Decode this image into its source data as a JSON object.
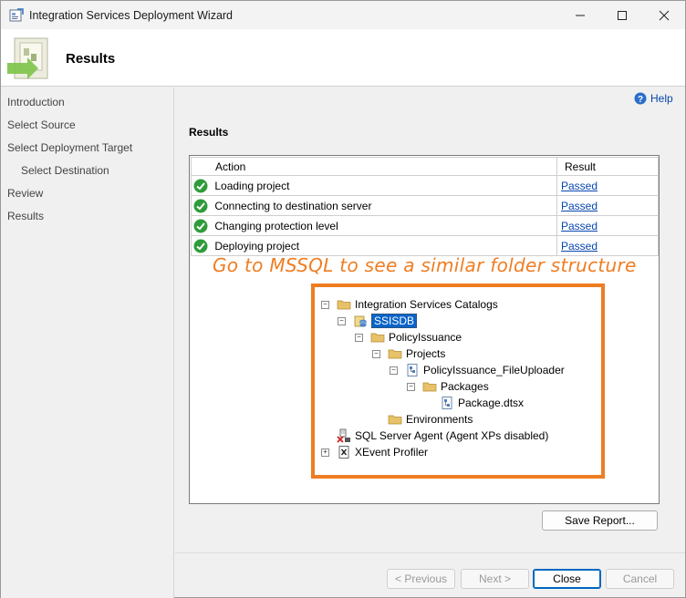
{
  "window": {
    "title": "Integration Services Deployment Wizard"
  },
  "header": {
    "title": "Results"
  },
  "nav": {
    "items": [
      {
        "label": "Introduction"
      },
      {
        "label": "Select Source"
      },
      {
        "label": "Select Deployment Target"
      },
      {
        "label": "Select Destination"
      },
      {
        "label": "Review"
      },
      {
        "label": "Results"
      }
    ]
  },
  "main": {
    "help_label": "Help",
    "section_title": "Results",
    "table": {
      "columns": [
        "Action",
        "Result"
      ],
      "rows": [
        {
          "action": "Loading project",
          "result": "Passed"
        },
        {
          "action": "Connecting to destination server",
          "result": "Passed"
        },
        {
          "action": "Changing protection level",
          "result": "Passed"
        },
        {
          "action": "Deploying project",
          "result": "Passed"
        }
      ]
    },
    "annotation": "Go to MSSQL to see a similar folder structure",
    "tree": [
      {
        "label": "Integration Services Catalogs",
        "icon": "folder-icon",
        "toggle": "minus"
      },
      {
        "label": "SSISDB",
        "icon": "database-icon",
        "toggle": "minus",
        "selected": true
      },
      {
        "label": "PolicyIssuance",
        "icon": "folder-icon",
        "toggle": "minus"
      },
      {
        "label": "Projects",
        "icon": "folder-icon",
        "toggle": "minus"
      },
      {
        "label": "PolicyIssuance_FileUploader",
        "icon": "project-icon",
        "toggle": "minus"
      },
      {
        "label": "Packages",
        "icon": "folder-icon",
        "toggle": "minus"
      },
      {
        "label": "Package.dtsx",
        "icon": "package-icon",
        "toggle": ""
      },
      {
        "label": "Environments",
        "icon": "folder-icon",
        "toggle": ""
      },
      {
        "label": "SQL Server Agent (Agent XPs disabled)",
        "icon": "agent-icon",
        "toggle": ""
      },
      {
        "label": "XEvent Profiler",
        "icon": "profiler-icon",
        "toggle": "plus"
      }
    ],
    "save_report_label": "Save Report..."
  },
  "footer": {
    "previous_label": "< Previous",
    "next_label": "Next >",
    "close_label": "Close",
    "cancel_label": "Cancel"
  },
  "colors": {
    "accent": "#0067c0",
    "annotation": "#ee7d22",
    "passed_link": "#0645ad",
    "check": "#2e9c3a"
  }
}
